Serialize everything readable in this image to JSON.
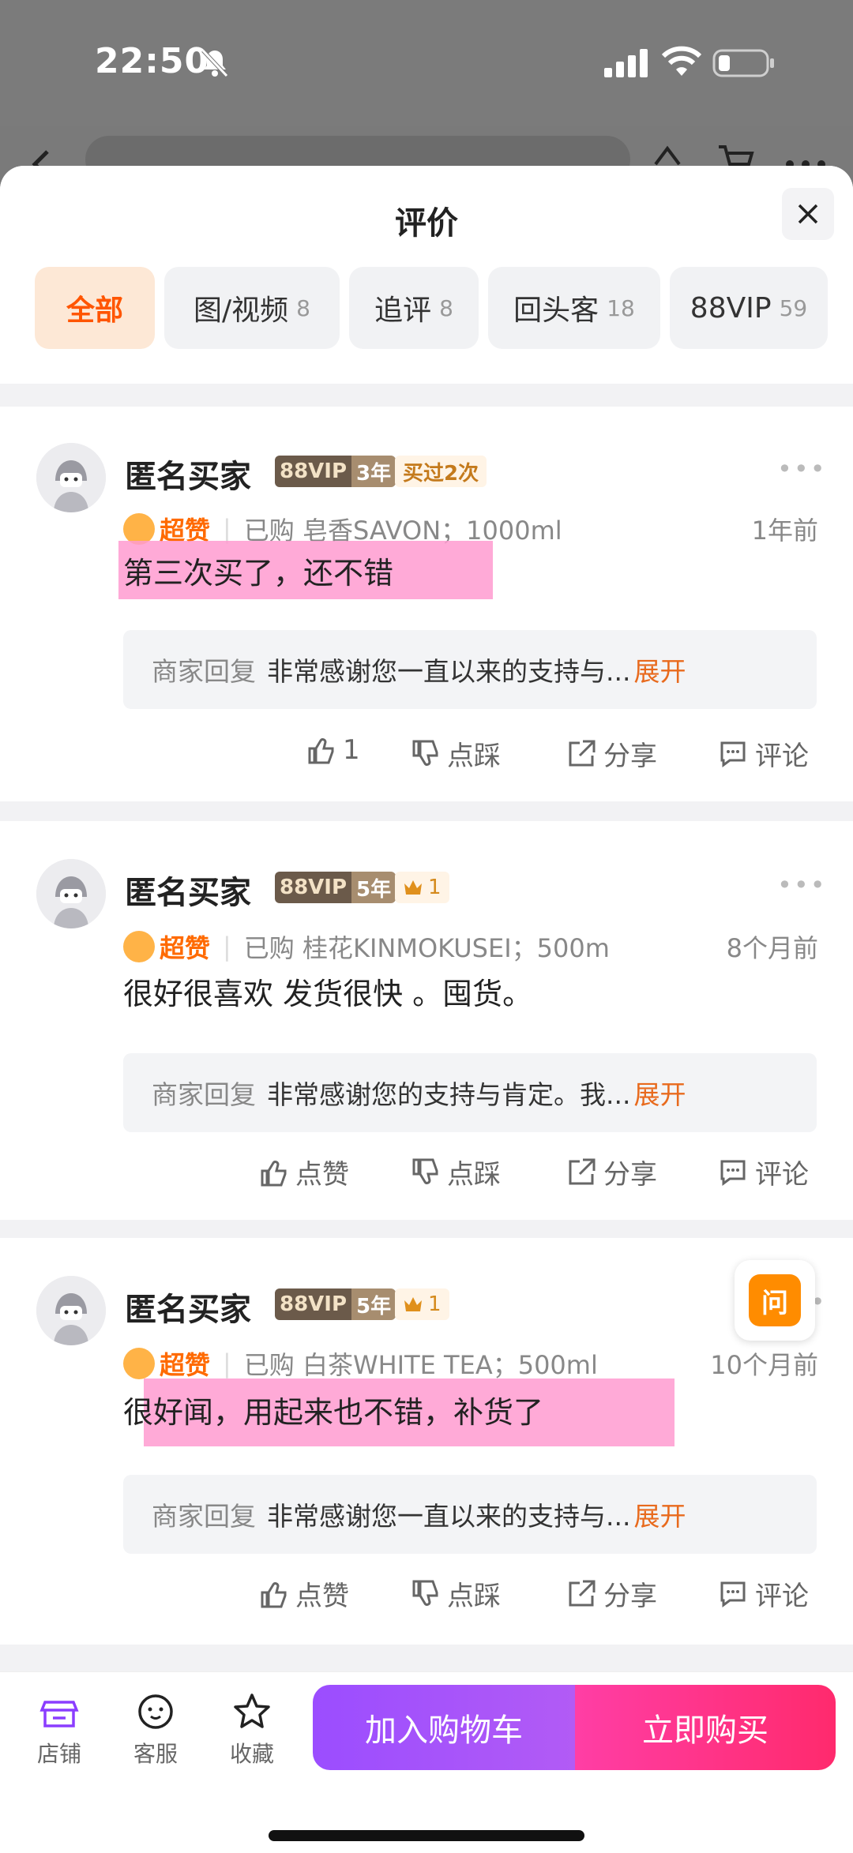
{
  "status_bar": {
    "time": "22:50"
  },
  "sheet": {
    "title": "评价",
    "tabs": [
      {
        "label": "全部",
        "count": ""
      },
      {
        "label": "图/视频",
        "count": "8"
      },
      {
        "label": "追评",
        "count": "8"
      },
      {
        "label": "回头客",
        "count": "18"
      },
      {
        "label": "88VIP",
        "count": "59"
      }
    ]
  },
  "reviews": [
    {
      "user": "匿名买家",
      "vip": "88VIP",
      "years": "3年",
      "extra_badge": "买过2次",
      "rating": "超赞",
      "purchased": "已购 皂香SAVON；1000ml",
      "ago": "1年前",
      "content": "第三次买了，还不错",
      "reply_who": "商家回复",
      "reply_text": "非常感谢您一直以来的支持与...",
      "reply_expand": "展开",
      "like": "1",
      "dislike": "点踩",
      "share": "分享",
      "comment": "评论"
    },
    {
      "user": "匿名买家",
      "vip": "88VIP",
      "years": "5年",
      "crown": "1",
      "rating": "超赞",
      "purchased": "已购 桂花KINMOKUSEI；500m",
      "ago": "8个月前",
      "content": "很好很喜欢 发货很快 。囤货。",
      "reply_who": "商家回复",
      "reply_text": "非常感谢您的支持与肯定。我...",
      "reply_expand": "展开",
      "like": "点赞",
      "dislike": "点踩",
      "share": "分享",
      "comment": "评论"
    },
    {
      "user": "匿名买家",
      "vip": "88VIP",
      "years": "5年",
      "crown": "1",
      "rating": "超赞",
      "purchased": "已购 白茶WHITE TEA；500ml",
      "ago": "10个月前",
      "content": "很好闻，用起来也不错，补货了",
      "reply_who": "商家回复",
      "reply_text": "非常感谢您一直以来的支持与...",
      "reply_expand": "展开",
      "like": "点赞",
      "dislike": "点踩",
      "share": "分享",
      "comment": "评论"
    }
  ],
  "ask_button": "问",
  "bottom_bar": {
    "store": "店铺",
    "service": "客服",
    "favorite": "收藏",
    "add_to_cart": "加入购物车",
    "buy_now": "立即购买"
  },
  "colors": {
    "accent": "#ff5500",
    "highlight": "#ff9bd0",
    "cart_button": "#a052ff",
    "buy_button": "#ff3388"
  }
}
